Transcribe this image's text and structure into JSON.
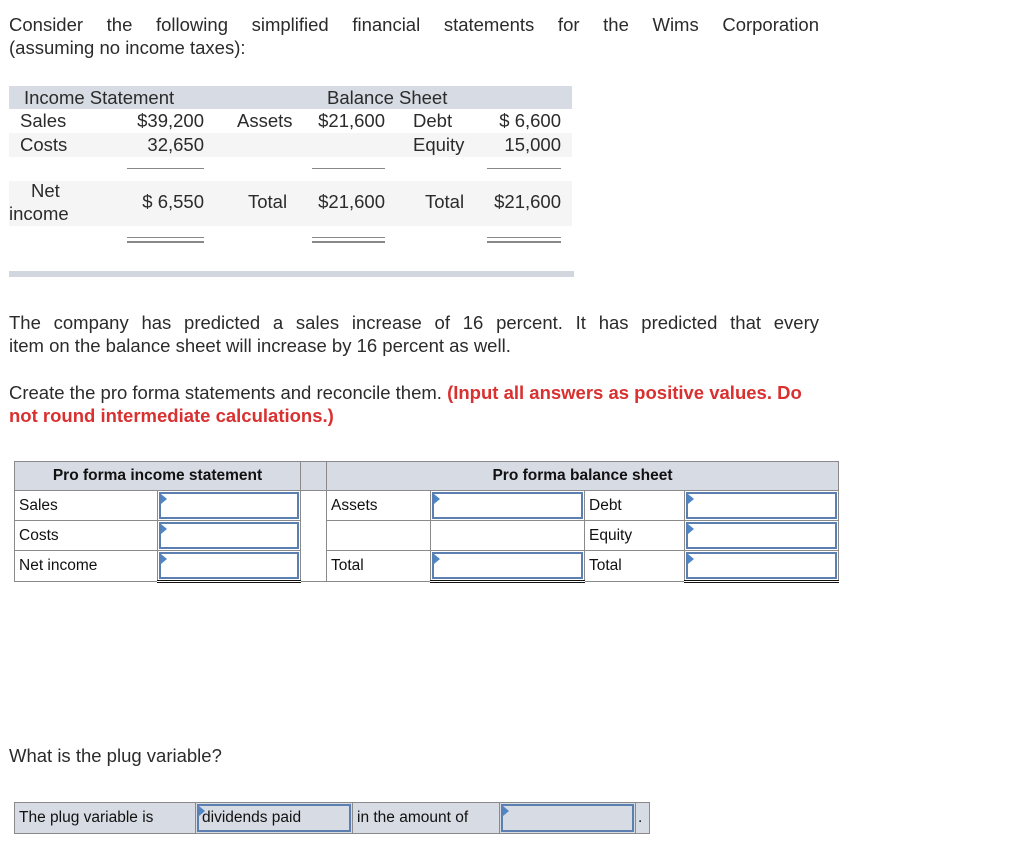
{
  "intro": {
    "line1": "Consider the following simplified financial statements for the Wims Corporation",
    "line2": "(assuming no income taxes):"
  },
  "given": {
    "income_statement_title": "Income Statement",
    "balance_sheet_title": "Balance Sheet",
    "income": {
      "sales_label": "Sales",
      "sales_value": "$39,200",
      "costs_label": "Costs",
      "costs_value": "32,650",
      "net_label_1": "Net",
      "net_label_2": "income",
      "net_value": "$ 6,550"
    },
    "assets": {
      "assets_label": "Assets",
      "assets_value": "$21,600",
      "total_label": "Total",
      "total_value": "$21,600"
    },
    "liabilities": {
      "debt_label": "Debt",
      "debt_value": "$ 6,600",
      "equity_label": "Equity",
      "equity_value": "15,000",
      "total_label": "Total",
      "total_value": "$21,600"
    }
  },
  "paragraph2": {
    "line1": "The company has predicted a sales increase of 16 percent. It has predicted that every",
    "line2": "item on the balance sheet will increase by 16 percent as well."
  },
  "instructions": {
    "text": "Create the pro forma statements and reconcile them.",
    "emphasis": "(Input all answers as positive values. Do not round intermediate calculations.)"
  },
  "pro_forma": {
    "income_header": "Pro forma income statement",
    "balance_header": "Pro forma balance sheet",
    "income_rows": [
      {
        "label": "Sales",
        "value": ""
      },
      {
        "label": "Costs",
        "value": ""
      },
      {
        "label": "Net income",
        "value": ""
      }
    ],
    "assets_rows": [
      {
        "label": "Assets",
        "value": ""
      },
      {
        "label": "",
        "value": ""
      },
      {
        "label": "Total",
        "value": ""
      }
    ],
    "liab_rows": [
      {
        "label": "Debt",
        "value": ""
      },
      {
        "label": "Equity",
        "value": ""
      },
      {
        "label": "Total",
        "value": ""
      }
    ]
  },
  "plug": {
    "question": "What is the plug variable?",
    "prefix": "The plug variable is",
    "selected_value": "dividends paid",
    "middle": "in the amount of",
    "amount_value": "",
    "suffix": "."
  }
}
